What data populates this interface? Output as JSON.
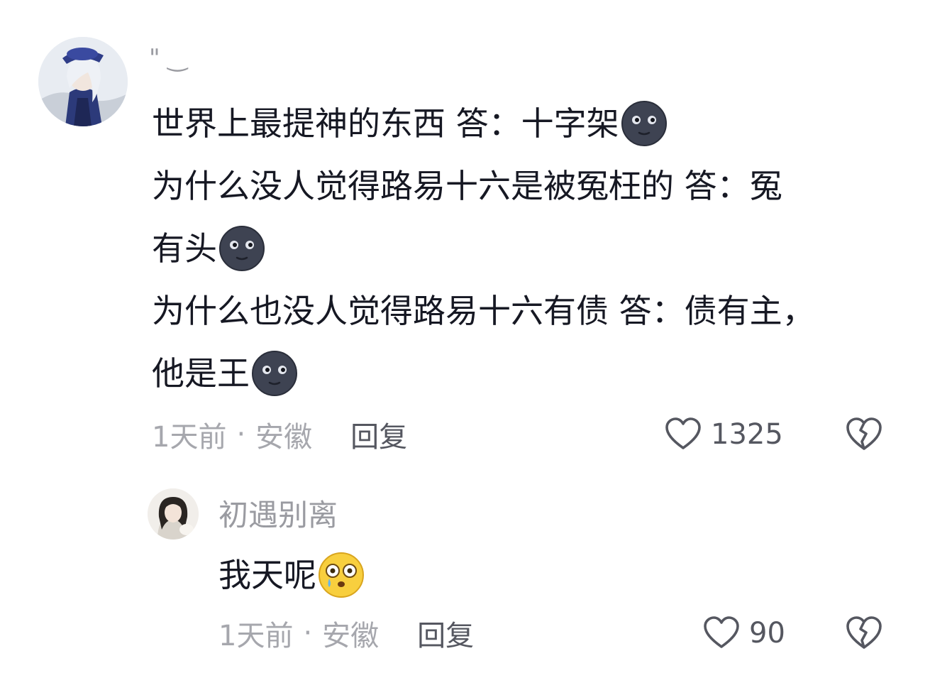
{
  "comment": {
    "username": "\" ‿",
    "lines": [
      "世界上最提神的东西  答：十字架",
      "为什么没人觉得路易十六是被冤枉的  答：冤",
      "有头",
      "为什么也没人觉得路易十六有债  答：债有主，",
      "他是王"
    ],
    "emoji_name": "new-moon-face-emoji",
    "time": "1天前",
    "separator": "·",
    "location": "安徽",
    "reply_label": "回复",
    "like_count": "1325"
  },
  "reply": {
    "username": "初遇别离",
    "text": "我天呢",
    "emoji_name": "flushed-crying-face-emoji",
    "time": "1天前",
    "separator": "·",
    "location": "安徽",
    "reply_label": "回复",
    "like_count": "90"
  },
  "colors": {
    "text_primary": "#161823",
    "text_secondary": "#9a9ba1",
    "icon": "#555760",
    "moon_emoji": "#3e4352"
  }
}
